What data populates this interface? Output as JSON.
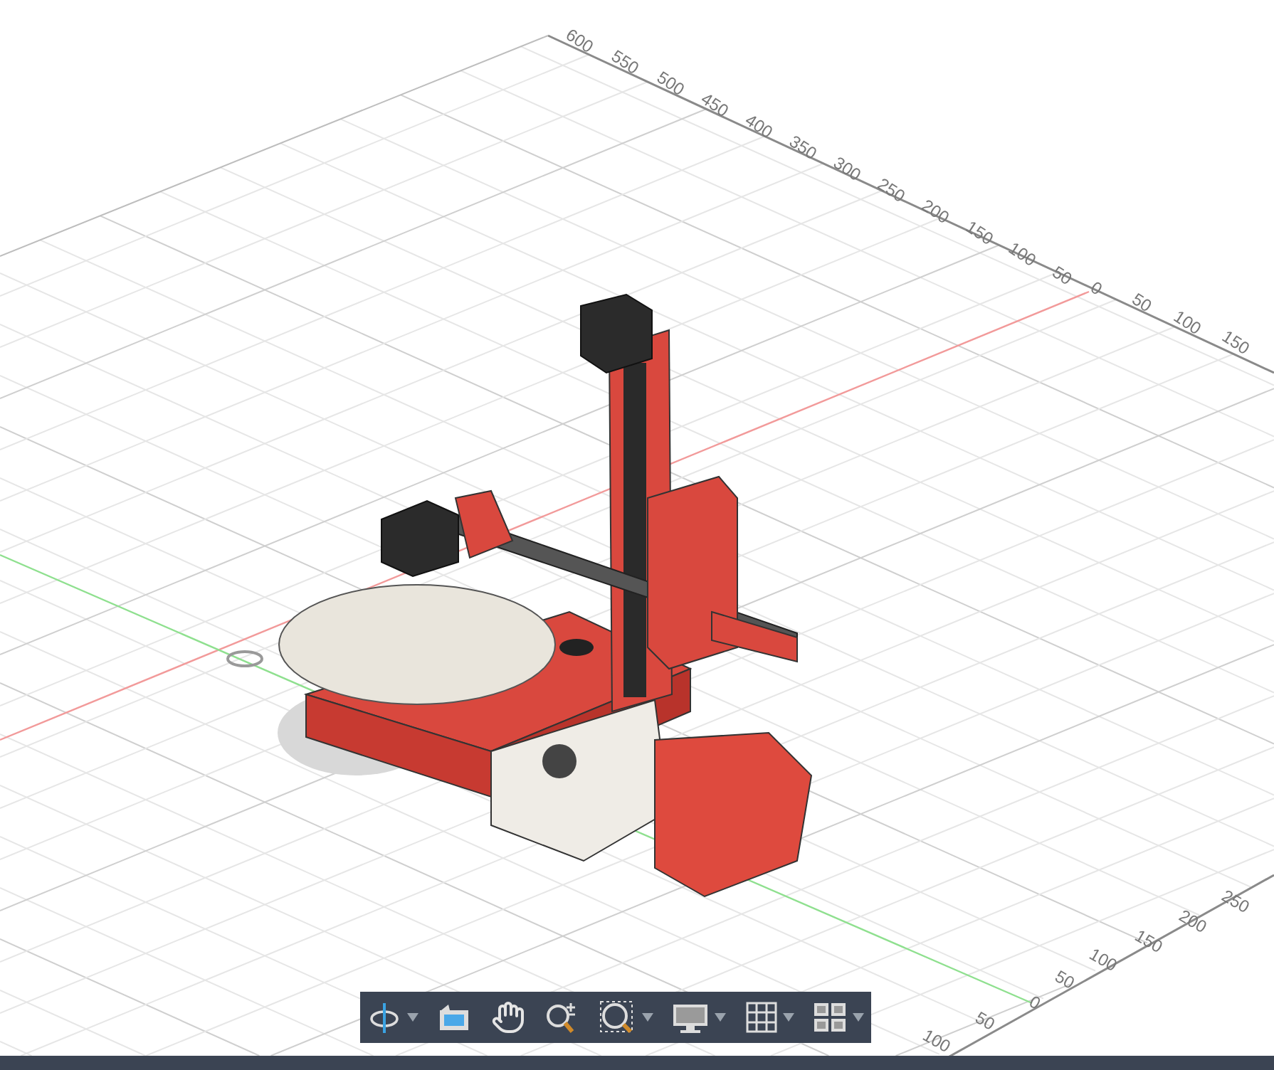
{
  "viewport": {
    "top_axis_labels": [
      "600",
      "550",
      "500",
      "450",
      "400",
      "350",
      "300",
      "250",
      "200",
      "150",
      "100",
      "50",
      "0",
      "50",
      "100",
      "150"
    ],
    "bottom_axis_labels": [
      "250",
      "200",
      "150",
      "100",
      "50",
      "0",
      "50",
      "100"
    ]
  }
}
